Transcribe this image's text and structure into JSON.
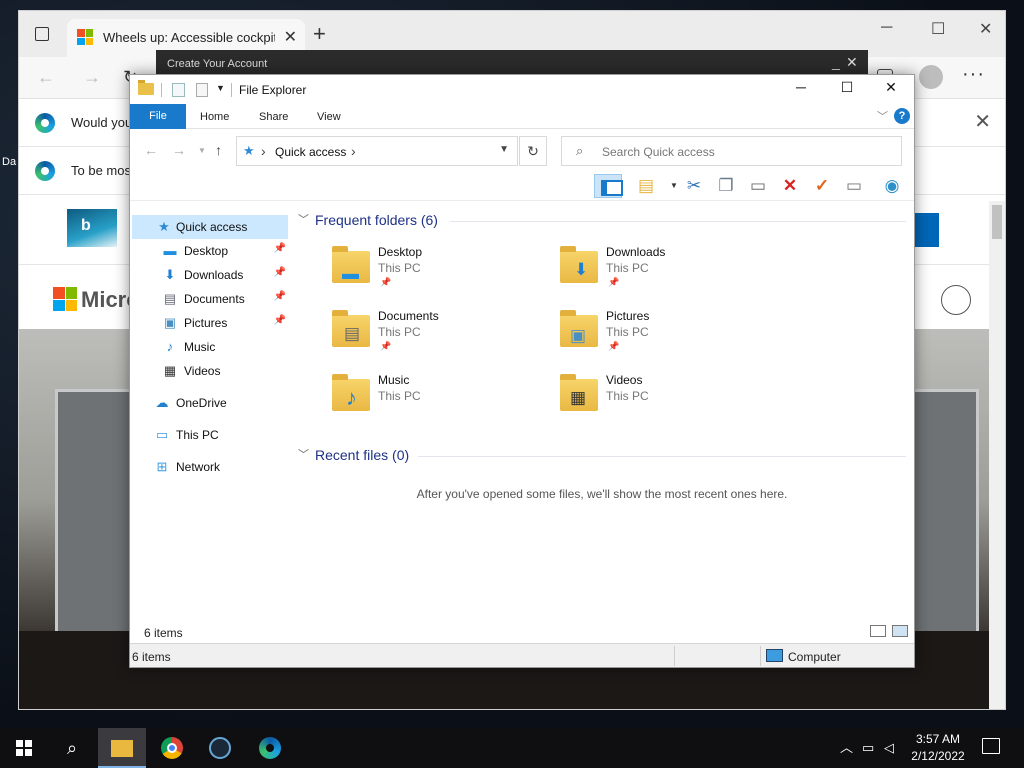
{
  "desktop": {
    "label": "Da"
  },
  "browser": {
    "tab_title": "Wheels up: Accessible cockpit fo",
    "tab_close": "✕",
    "new_tab": "+",
    "more": "···",
    "info_bar_1": "Would you",
    "info_bar_2": "To be mos",
    "brand": "Micro",
    "overlay_window_title": "Create Your Account"
  },
  "explorer": {
    "title": "File Explorer",
    "ribbon_tabs": [
      "File",
      "Home",
      "Share",
      "View"
    ],
    "help": "?",
    "address": "Quick access",
    "search_placeholder": "Search Quick access",
    "sidebar": {
      "quick_access": "Quick access",
      "pinned": [
        {
          "label": "Desktop",
          "icon": "desktop-icon"
        },
        {
          "label": "Downloads",
          "icon": "download-icon"
        },
        {
          "label": "Documents",
          "icon": "document-icon"
        },
        {
          "label": "Pictures",
          "icon": "picture-icon"
        }
      ],
      "music": "Music",
      "videos": "Videos",
      "onedrive": "OneDrive",
      "this_pc": "This PC",
      "network": "Network"
    },
    "frequent_header": "Frequent folders (6)",
    "folders": [
      {
        "name": "Desktop",
        "location": "This PC",
        "pinned": true,
        "icon": "desktop-icon"
      },
      {
        "name": "Downloads",
        "location": "This PC",
        "pinned": true,
        "icon": "download-icon"
      },
      {
        "name": "Documents",
        "location": "This PC",
        "pinned": true,
        "icon": "document-icon"
      },
      {
        "name": "Pictures",
        "location": "This PC",
        "pinned": true,
        "icon": "picture-icon"
      },
      {
        "name": "Music",
        "location": "This PC",
        "pinned": false,
        "icon": "music-icon"
      },
      {
        "name": "Videos",
        "location": "This PC",
        "pinned": false,
        "icon": "video-icon"
      }
    ],
    "recent_header": "Recent files (0)",
    "recent_message": "After you've opened some files, we'll show the most recent ones here.",
    "item_count": "6 items",
    "statusbar_count": "6 items",
    "statusbar_location": "Computer",
    "colors": {
      "accent": "#1979ca",
      "selection": "#cce8ff",
      "heading": "#1e3287"
    }
  },
  "taskbar": {
    "time": "3:57 AM",
    "date": "2/12/2022",
    "pinned": [
      "file-explorer",
      "chrome",
      "steam",
      "edge"
    ]
  }
}
